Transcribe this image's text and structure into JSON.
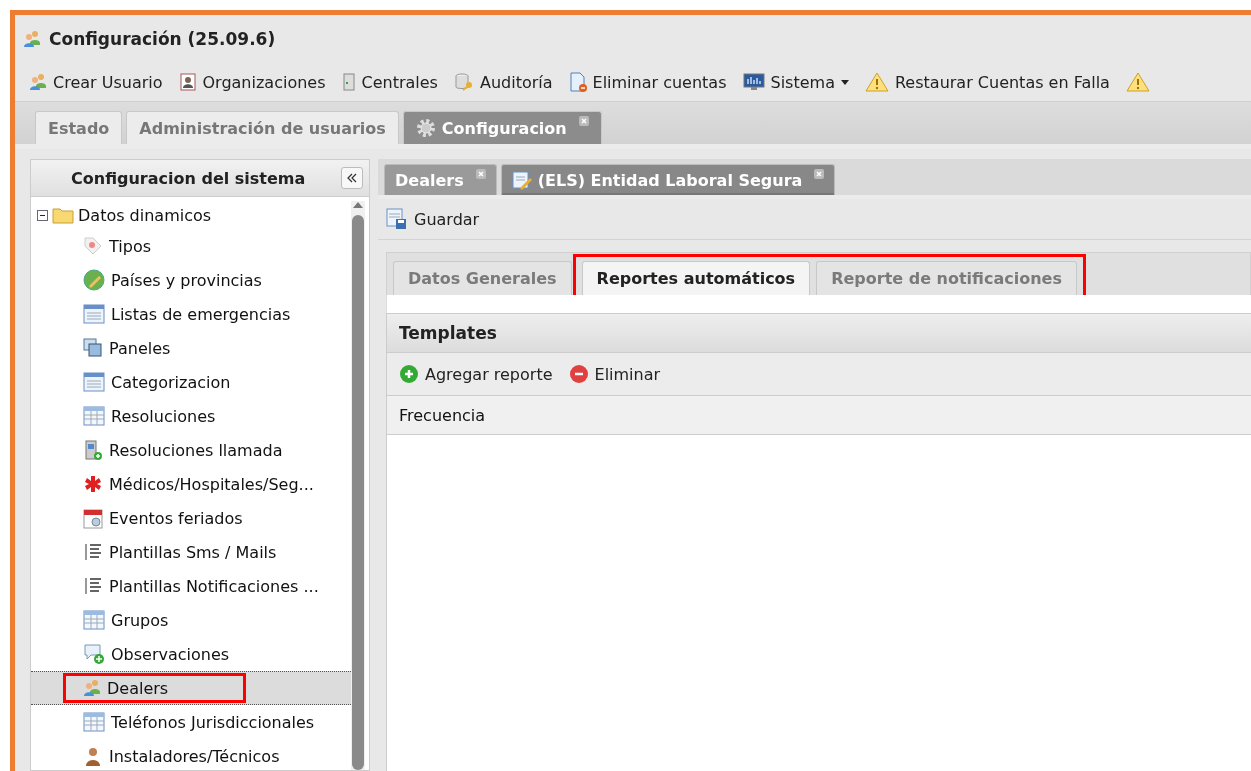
{
  "window": {
    "title": "Configuración (25.09.6)"
  },
  "toolbar": [
    {
      "label": "Crear Usuario",
      "menu": false
    },
    {
      "label": "Organizaciones",
      "menu": false
    },
    {
      "label": "Centrales",
      "menu": false
    },
    {
      "label": "Auditoría",
      "menu": false
    },
    {
      "label": "Eliminar cuentas",
      "menu": false
    },
    {
      "label": "Sistema",
      "menu": true
    },
    {
      "label": "Restaurar Cuentas en Falla",
      "menu": false
    }
  ],
  "main_tabs": [
    {
      "label": "Estado",
      "selected": false,
      "closable": false
    },
    {
      "label": "Administración de usuarios",
      "selected": false,
      "closable": false
    },
    {
      "label": "Configuracion",
      "selected": true,
      "closable": true
    }
  ],
  "sidebar": {
    "title": "Configuracion del sistema",
    "items": [
      {
        "label": "Datos dinamicos",
        "expanded": true,
        "children": [
          {
            "label": "Tipos",
            "selected": false,
            "highlighted": false
          },
          {
            "label": "Países y provincias",
            "selected": false,
            "highlighted": false
          },
          {
            "label": "Listas de emergencias",
            "selected": false,
            "highlighted": false
          },
          {
            "label": "Paneles",
            "selected": false,
            "highlighted": false
          },
          {
            "label": "Categorizacion",
            "selected": false,
            "highlighted": false
          },
          {
            "label": "Resoluciones",
            "selected": false,
            "highlighted": false
          },
          {
            "label": "Resoluciones llamada",
            "selected": false,
            "highlighted": false
          },
          {
            "label": "Médicos/Hospitales/Seg...",
            "selected": false,
            "highlighted": false
          },
          {
            "label": "Eventos feriados",
            "selected": false,
            "highlighted": false
          },
          {
            "label": "Plantillas Sms / Mails",
            "selected": false,
            "highlighted": false
          },
          {
            "label": "Plantillas Notificaciones ...",
            "selected": false,
            "highlighted": false
          },
          {
            "label": "Grupos",
            "selected": false,
            "highlighted": false
          },
          {
            "label": "Observaciones",
            "selected": false,
            "highlighted": false
          },
          {
            "label": "Dealers",
            "selected": true,
            "highlighted": true
          },
          {
            "label": "Teléfonos Jurisdiccionales",
            "selected": false,
            "highlighted": false
          },
          {
            "label": "Instaladores/Técnicos",
            "selected": false,
            "highlighted": false
          }
        ]
      }
    ]
  },
  "detail_tabs": [
    {
      "label": "Dealers",
      "selected": false
    },
    {
      "label": "(ELS) Entidad Laboral Segura",
      "selected": true
    }
  ],
  "save_button": "Guardar",
  "form_tabs": [
    {
      "label": "Datos Generales",
      "selected": false,
      "highlighted": false
    },
    {
      "label": "Reportes automáticos",
      "selected": true,
      "highlighted": true
    },
    {
      "label": "Reporte de notificaciones",
      "selected": false,
      "highlighted": true
    }
  ],
  "templates": {
    "title": "Templates",
    "actions": [
      {
        "label": "Agregar reporte",
        "kind": "add"
      },
      {
        "label": "Eliminar",
        "kind": "remove"
      }
    ],
    "columns": [
      "Frecuencia"
    ]
  }
}
